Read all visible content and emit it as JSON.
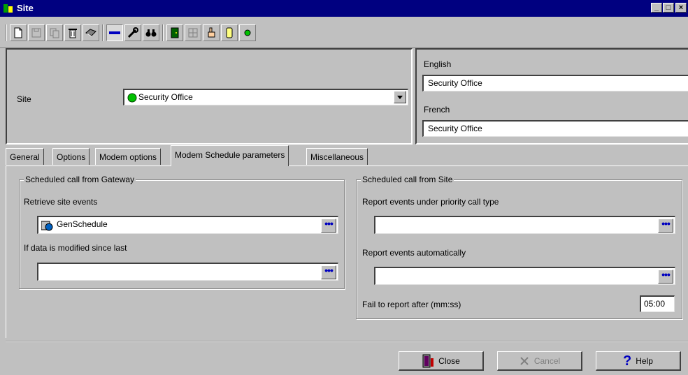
{
  "window": {
    "title": "Site"
  },
  "site": {
    "label": "Site",
    "selected": "Security Office"
  },
  "translations": {
    "english_label": "English",
    "english_value": "Security Office",
    "french_label": "French",
    "french_value": "Security Office"
  },
  "tabs": [
    {
      "label": "General"
    },
    {
      "label": "Options"
    },
    {
      "label": "Modem options"
    },
    {
      "label": "Modem Schedule parameters"
    },
    {
      "label": "Miscellaneous"
    }
  ],
  "gateway_group": {
    "title": "Scheduled call from Gateway",
    "retrieve_label": "Retrieve site events",
    "retrieve_value": "GenSchedule",
    "modified_label": "If data is modified since last",
    "modified_value": ""
  },
  "site_group": {
    "title": "Scheduled call from Site",
    "priority_label": "Report events under priority call type",
    "priority_value": "",
    "auto_label": "Report events automatically",
    "auto_value": "",
    "fail_label": "Fail to report after (mm:ss)",
    "fail_value": "05:00"
  },
  "buttons": {
    "close": "Close",
    "cancel": "Cancel",
    "help": "Help"
  },
  "icons": {
    "app": "site-app-icon",
    "new": "new-icon",
    "save": "save-icon",
    "copy": "copy-icon",
    "delete": "delete-icon",
    "print": "print-icon",
    "link": "link-icon",
    "wrench": "wrench-icon",
    "find": "binoculars-icon",
    "status": "status-dot-icon",
    "ellipsis": "ellipsis-icon"
  },
  "colors": {
    "titlebar": "#000080",
    "status_green": "#00c000",
    "ellipsis_blue": "#0000c0"
  }
}
